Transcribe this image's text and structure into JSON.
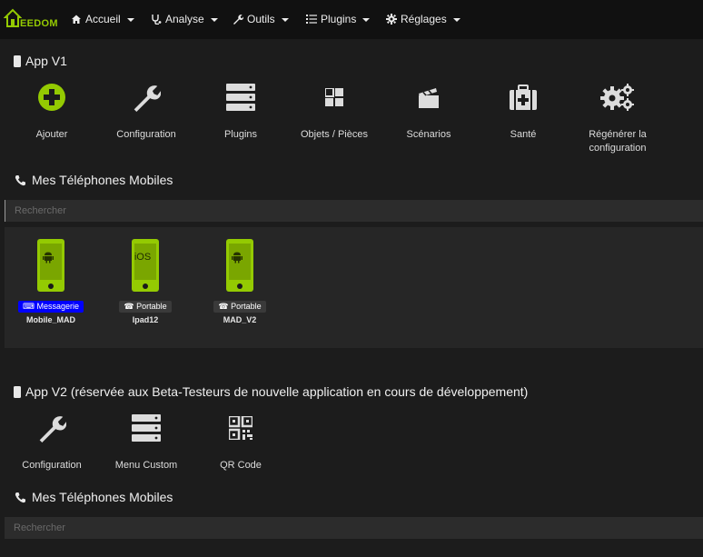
{
  "navbar": {
    "brand": "EEDOM",
    "items": [
      {
        "label": "Accueil",
        "icon": "home-icon"
      },
      {
        "label": "Analyse",
        "icon": "stethoscope-icon"
      },
      {
        "label": "Outils",
        "icon": "wrench-icon"
      },
      {
        "label": "Plugins",
        "icon": "list-icon"
      },
      {
        "label": "Réglages",
        "icon": "gear-icon"
      }
    ]
  },
  "app_v1": {
    "title": "App V1",
    "actions": [
      {
        "label": "Ajouter",
        "icon": "plus-circle-icon"
      },
      {
        "label": "Configuration",
        "icon": "wrench-icon"
      },
      {
        "label": "Plugins",
        "icon": "server-icon"
      },
      {
        "label": "Objets / Pièces",
        "icon": "grid-icon"
      },
      {
        "label": "Scénarios",
        "icon": "clapperboard-icon"
      },
      {
        "label": "Santé",
        "icon": "medkit-icon"
      },
      {
        "label": "Régénérer la configuration",
        "icon": "gears-icon"
      }
    ],
    "phones_title": "Mes Téléphones Mobiles",
    "search_placeholder": "Rechercher",
    "devices": [
      {
        "name": "Mobile_MAD",
        "os": "android",
        "badge": "Messagerie",
        "badge_color": "#0000ff",
        "badge_icon": "keyboard-icon"
      },
      {
        "name": "Ipad12",
        "os": "iOS",
        "badge": "Portable",
        "badge_color": "#3a3a3a",
        "badge_icon": "phone-icon"
      },
      {
        "name": "MAD_V2",
        "os": "android",
        "badge": "Portable",
        "badge_color": "#3a3a3a",
        "badge_icon": "phone-icon"
      }
    ]
  },
  "app_v2": {
    "title": "App V2 (réservée aux Beta-Testeurs de nouvelle application en cours de développement)",
    "actions": [
      {
        "label": "Configuration",
        "icon": "wrench-icon"
      },
      {
        "label": "Menu Custom",
        "icon": "server-icon"
      },
      {
        "label": "QR Code",
        "icon": "qrcode-icon"
      }
    ],
    "phones_title": "Mes Téléphones Mobiles",
    "search_placeholder": "Rechercher"
  },
  "colors": {
    "accent": "#94ca02",
    "background": "#1c1c1c",
    "navbar": "#111111",
    "messagerie_badge": "#0000ff"
  }
}
